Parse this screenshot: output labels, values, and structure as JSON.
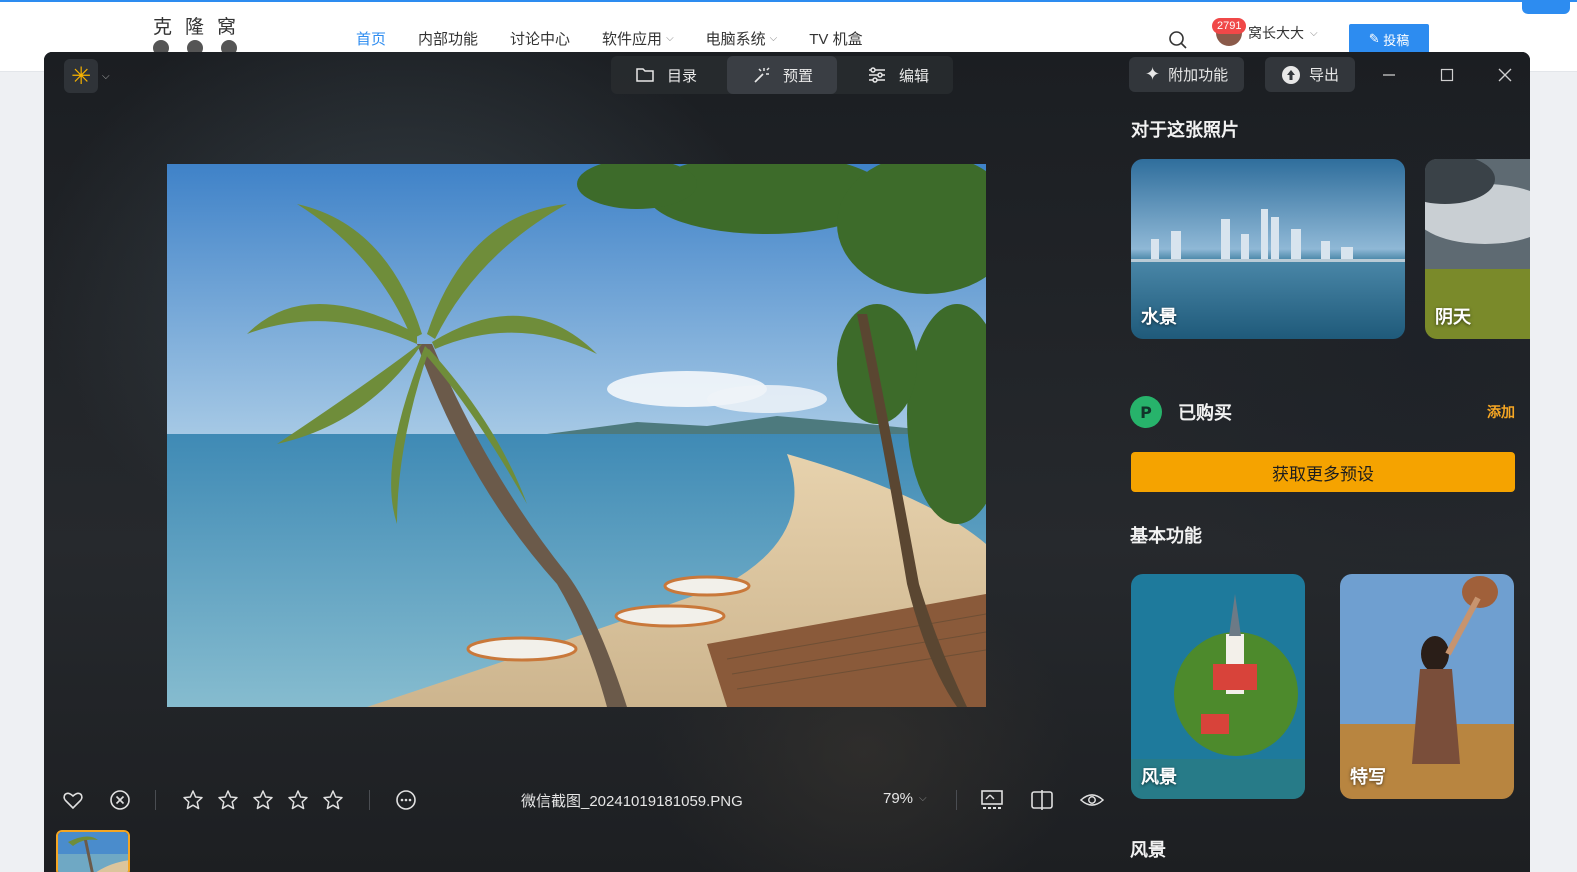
{
  "site": {
    "logo_text": "克隆窝",
    "nav": [
      {
        "label": "首页",
        "active": true,
        "dropdown": false
      },
      {
        "label": "内部功能",
        "active": false,
        "dropdown": false
      },
      {
        "label": "讨论中心",
        "active": false,
        "dropdown": false
      },
      {
        "label": "软件应用",
        "active": false,
        "dropdown": true
      },
      {
        "label": "电脑系统",
        "active": false,
        "dropdown": true
      },
      {
        "label": "TV 机盒",
        "active": false,
        "dropdown": false
      }
    ],
    "notification_count": "2791",
    "username": "窝长大大",
    "post_button": "投稿",
    "accent_color": "#2d8cf0"
  },
  "app": {
    "tabs": [
      {
        "label": "目录",
        "icon": "folder-icon"
      },
      {
        "label": "预置",
        "icon": "magic-wand-icon",
        "active": true
      },
      {
        "label": "编辑",
        "icon": "sliders-icon"
      }
    ],
    "addons_label": "附加功能",
    "export_label": "导出",
    "filename": "微信截图_20241019181059.PNG",
    "zoom": "79%",
    "rating_stars": 5,
    "rating_value": 0,
    "accent_color": "#f5a300"
  },
  "panel": {
    "about_title": "对于这张照片",
    "about_cards": [
      {
        "label": "水景"
      },
      {
        "label": "阴天"
      }
    ],
    "purchased_label": "已购买",
    "add_label": "添加",
    "get_more_label": "获取更多预设",
    "basic_title": "基本功能",
    "basic_cards": [
      {
        "label": "风景"
      },
      {
        "label": "特写"
      }
    ],
    "next_section_title": "风景"
  }
}
